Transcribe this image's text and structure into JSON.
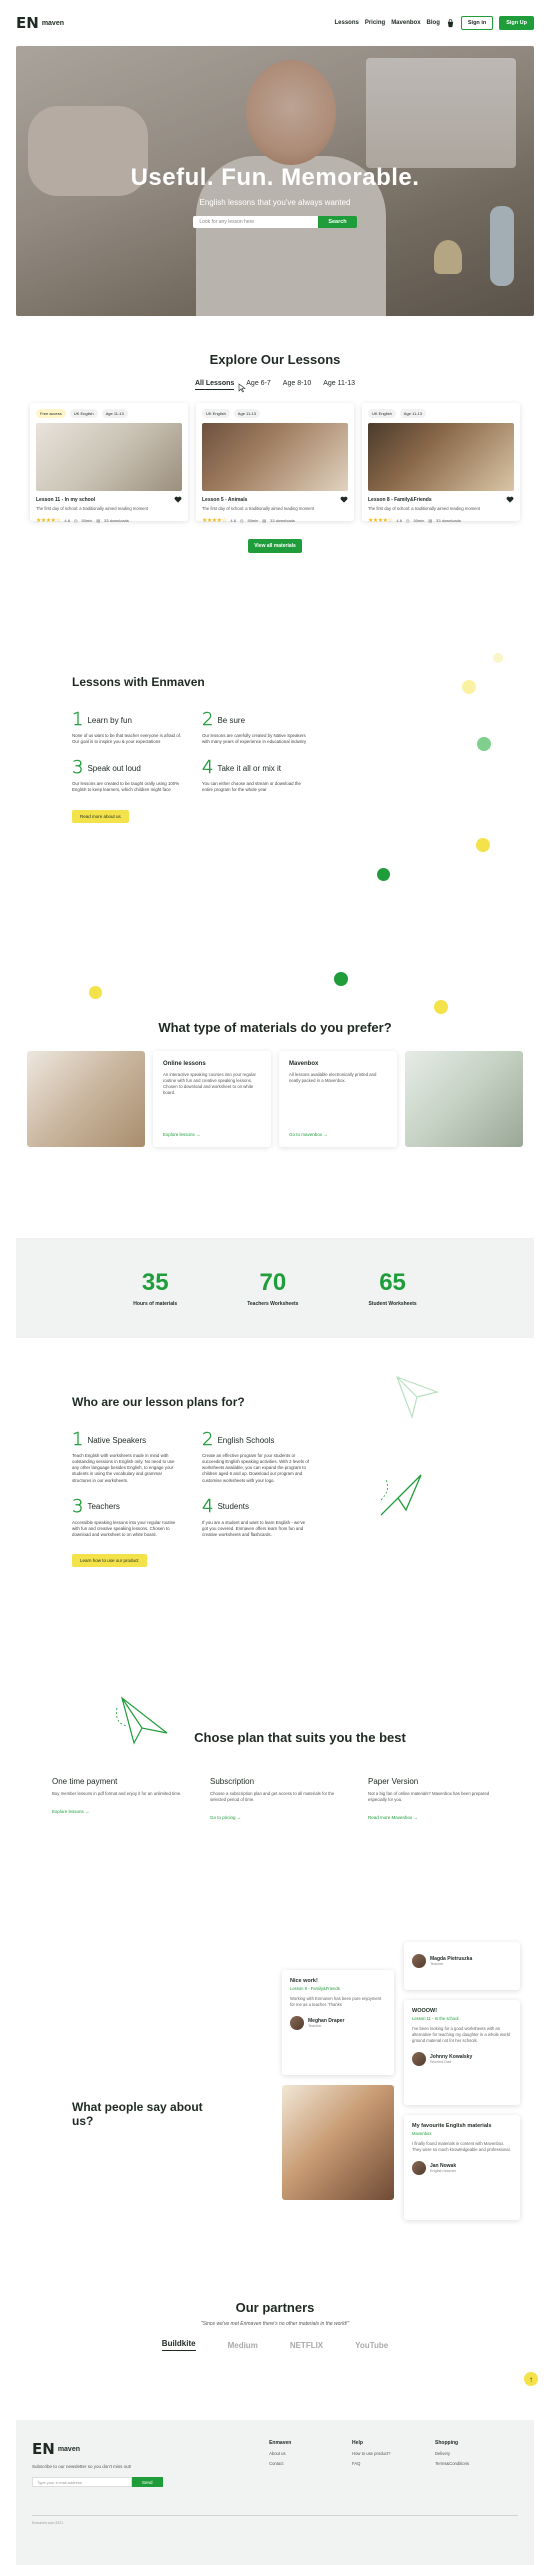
{
  "nav": {
    "logo_mark": "EN",
    "logo_text": "maven",
    "links": [
      "Lessons",
      "Pricing",
      "Mavenbox",
      "Blog"
    ],
    "sign_in": "Sign in",
    "sign_up": "Sign Up"
  },
  "hero": {
    "title": "Useful. Fun. Memorable.",
    "subtitle": "English lessons that you've always wanted",
    "search_placeholder": "Look for any lesson here",
    "search_button": "Search"
  },
  "lessons": {
    "title": "Explore Our Lessons",
    "tabs": [
      "All Lessons",
      "Age 6-7",
      "Age 8-10",
      "Age 11-13"
    ],
    "active_tab": 0,
    "cards": [
      {
        "chips": [
          "Free access",
          "UK English",
          "Age 11-13"
        ],
        "title": "Lesson 11 - In my school",
        "desc": "The first day of school: a traditionally aimed reading moment",
        "rating": "4.8",
        "time": "50min",
        "downloads": "33 downloads"
      },
      {
        "chips": [
          "UK English",
          "Age 11-13"
        ],
        "title": "Lesson 5 - Animals",
        "desc": "The first day of school: a traditionally aimed reading moment",
        "rating": "4.8",
        "time": "50min",
        "downloads": "33 downloads"
      },
      {
        "chips": [
          "UK English",
          "Age 11-13"
        ],
        "title": "Lesson 8 - Family&Friends",
        "desc": "The first day of school: a traditionally aimed reading moment",
        "rating": "4.8",
        "time": "50min",
        "downloads": "33 downloads"
      }
    ],
    "view_all": "View all materials"
  },
  "with_enmaven": {
    "title": "Lessons with Enmaven",
    "features": [
      {
        "num": "1",
        "name": "Learn by fun",
        "desc": "None of us want to be that teacher everyone is afraid of. Our goal is to inspire you & your expectations"
      },
      {
        "num": "2",
        "name": "Be sure",
        "desc": "Our lessons are carefully created by Native Speakers with many years of experience in educational industry"
      },
      {
        "num": "3",
        "name": "Speak out loud",
        "desc": "Our lessons are created to be taught orally using 100% English to keep learners, which children might face"
      },
      {
        "num": "4",
        "name": "Take it all or mix it",
        "desc": "You can either choose and stream or download the entire program for the whole year"
      }
    ],
    "button": "Read more about us"
  },
  "materials": {
    "title": "What type of materials do you prefer?",
    "cards": [
      {
        "title": "Online lessons",
        "desc": "An interactive speaking courses into your regular routine with fun and creative speaking lessons. Chosen to download and worksheet to on white board.",
        "link": "Explore lessons →"
      },
      {
        "title": "Mavenbox",
        "desc": "All lessons available electronically printed and neatly packed in a Mavenbox.",
        "link": "Go to mavenbox →"
      }
    ]
  },
  "stats": [
    {
      "num": "35",
      "label": "Hours of materials"
    },
    {
      "num": "70",
      "label": "Teachers Worksheets"
    },
    {
      "num": "65",
      "label": "Student Worksheets"
    }
  ],
  "who": {
    "title": "Who are our lesson plans for?",
    "features": [
      {
        "num": "1",
        "name": "Native Speakers",
        "desc": "Teach English with worksheets made in mind with outstanding sessions in English only. No need to use any other language besides English, to engage your students in using the vocabulary and grammar structures in our worksheets."
      },
      {
        "num": "2",
        "name": "English Schools",
        "desc": "Create an effective program for your students or succeeding English speaking activities. With 2 levels of worksheets available, you can expand the program to children aged 6 and up. Download our program and customise worksheets with your logo."
      },
      {
        "num": "3",
        "name": "Teachers",
        "desc": "Accessible speaking lessons into your regular routine with fun and creative speaking lessons. Chosen to download and worksheet to on white board."
      },
      {
        "num": "4",
        "name": "Students",
        "desc": "If you are a student and want to learn English - we've got you covered. Enmaven offers learn from fun and creative worksheets and flashcards."
      }
    ],
    "button": "Learn how to use our product"
  },
  "plans": {
    "title": "Chose plan that suits you the best",
    "items": [
      {
        "name": "One time payment",
        "desc": "Buy member lessons in pdf format and enjoy it for an unlimited time.",
        "link": "Explore lessons →"
      },
      {
        "name": "Subscription",
        "desc": "Choose a subscription plan and get access to all materials for the selected period of time.",
        "link": "Go to pricing →"
      },
      {
        "name": "Paper Version",
        "desc": "Not a big fan of online materials? Mavenbox has been prepared especially for you.",
        "link": "Read more Mavenbox →"
      }
    ]
  },
  "reviews": {
    "title": "What people say about us?",
    "items": [
      {
        "head": "Nice work!",
        "sub": "Lesson 8 - Family&Friends",
        "text": "Working with Enmaven has been pure enjoyment for me as a teacher. Thanks",
        "name": "Meghan Draper",
        "role": "Teacher"
      },
      {
        "head": "",
        "sub": "",
        "text": "",
        "name": "Magda Pietruszka",
        "role": "Teacher"
      },
      {
        "head": "WOOOW!",
        "sub": "Lesson 11 - In the school",
        "text": "I've been looking for a good worksheets with an alternative for teaching my daughter in a whole world ground material not for her schools.",
        "name": "Johnny Kowalsky",
        "role": "Worried Dad"
      },
      {
        "head": "My favourite English materials",
        "sub": "Mavenbox",
        "text": "I finally found materials in content with Mavenbox. They were so much knowledgeable and professional.",
        "name": "Jan Nowak",
        "role": "English teacher"
      }
    ]
  },
  "partners": {
    "title": "Our partners",
    "quote": "\"Since we've met Enmaven there's no other materials in the world!\"",
    "logos": [
      "Buildkite",
      "Medium",
      "NETFLIX",
      "YouTube"
    ]
  },
  "footer": {
    "subscribe": "Subscribe to our newsletter so you don't miss out!",
    "placeholder": "Type your e-mail address",
    "button": "Send",
    "cols": [
      {
        "title": "Enmaven",
        "items": [
          "About us",
          "Contact"
        ]
      },
      {
        "title": "Help",
        "items": [
          "How to use product?",
          "FAQ"
        ]
      },
      {
        "title": "Shopping",
        "items": [
          "Delivery",
          "Terms&Conditions"
        ]
      }
    ],
    "copyright": "Enmaven.com 2021"
  },
  "colors": {
    "accent": "#1f9d3a",
    "yellow": "#f4e24a"
  }
}
